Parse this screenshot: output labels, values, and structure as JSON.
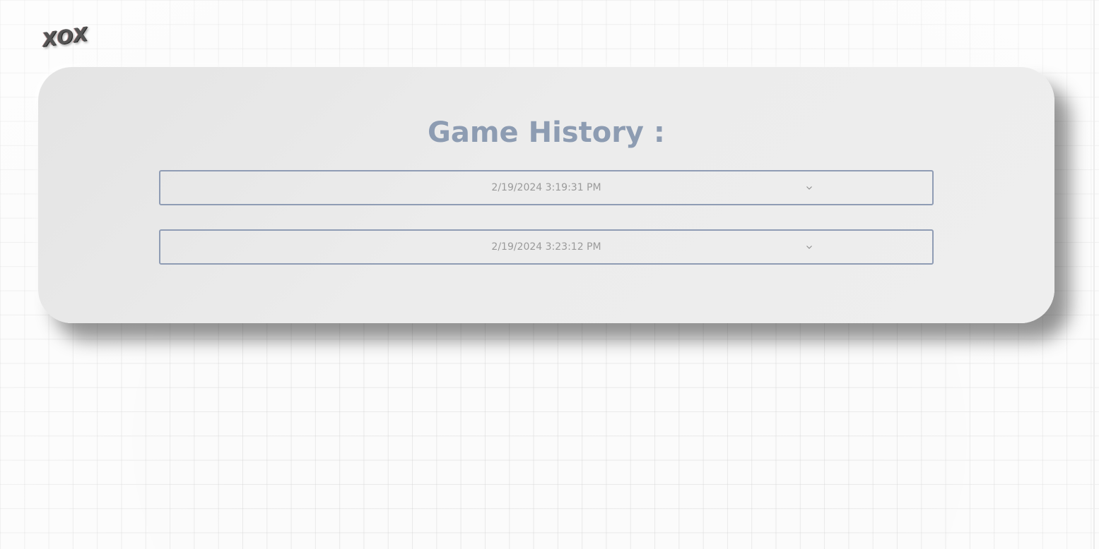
{
  "app": {
    "logo_text": "XOX"
  },
  "history": {
    "title": "Game History :",
    "items": [
      {
        "date": "2/19/2024 3:19:31 PM",
        "icon": "chevron-down-icon"
      },
      {
        "date": "2/19/2024 3:23:12 PM",
        "icon": "chevron-down-icon"
      }
    ]
  },
  "colors": {
    "title": "#8d9cb2",
    "item_border": "#8f9cb4",
    "item_text": "#9a9a9a",
    "card_background": "#eaeaea"
  }
}
